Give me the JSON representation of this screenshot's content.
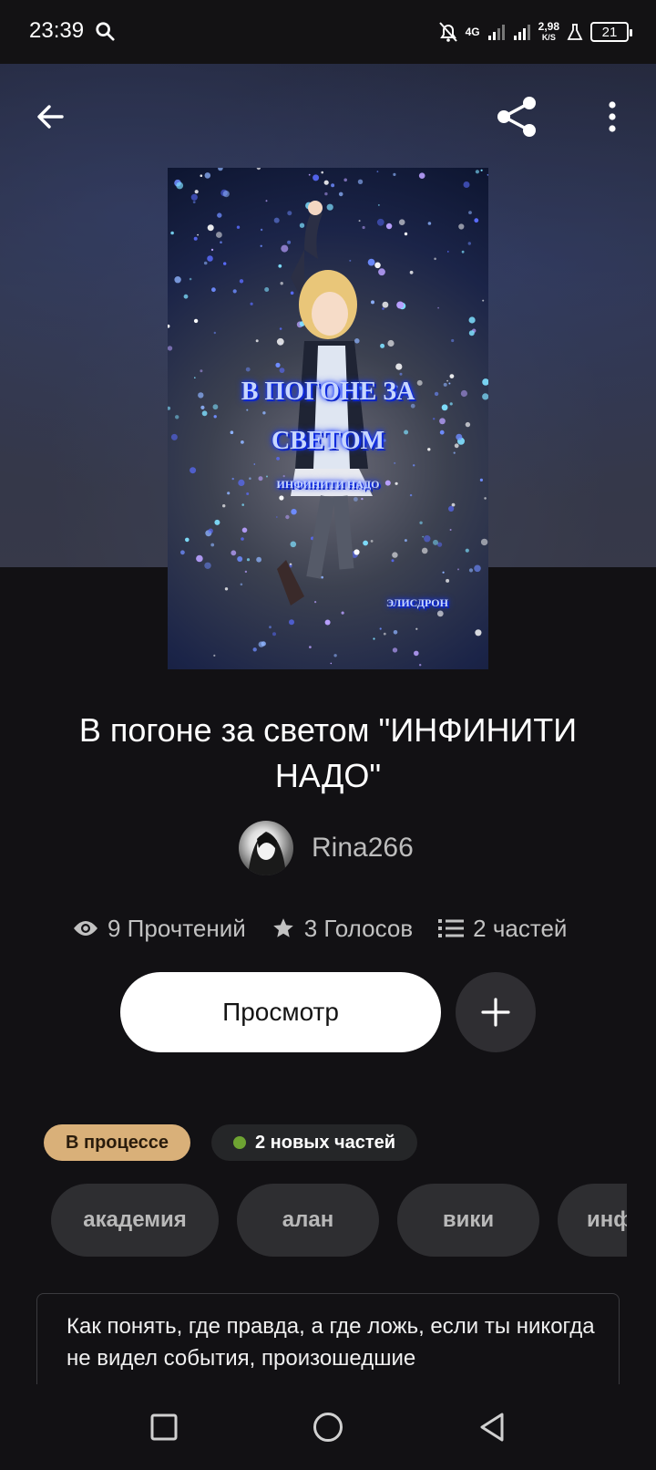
{
  "status_bar": {
    "time": "23:39",
    "network": "4G",
    "speed_value": "2,98",
    "speed_unit": "K/S",
    "battery": "21"
  },
  "header": {
    "back_icon": "arrow-left-icon",
    "share_icon": "share-icon",
    "more_icon": "more-vertical-icon"
  },
  "cover": {
    "title_line1": "В ПОГОНЕ ЗА",
    "title_line2": "СВЕТОМ",
    "subtitle": "ИНФИНИТИ НАДО",
    "author": "ЭЛИСДРОН"
  },
  "story": {
    "title": "В погоне за светом \"ИНФИНИТИ НАДО\"",
    "author": "Rina266"
  },
  "stats": {
    "reads": "9 Прочтений",
    "votes": "3 Голосов",
    "parts": "2 частей"
  },
  "actions": {
    "view_label": "Просмотр",
    "add_icon": "plus-icon"
  },
  "badges": {
    "status": "В процессе",
    "new_parts": "2 новых частей"
  },
  "tags": [
    "академия",
    "алан",
    "вики",
    "инф"
  ],
  "description": "Как понять, где правда, а где ложь, если ты никогда не видел события, произошедшие",
  "colors": {
    "background": "#121114",
    "status_badge": "#d9b079",
    "new_dot": "#6ea332",
    "tag_bg": "#2e2e31"
  }
}
